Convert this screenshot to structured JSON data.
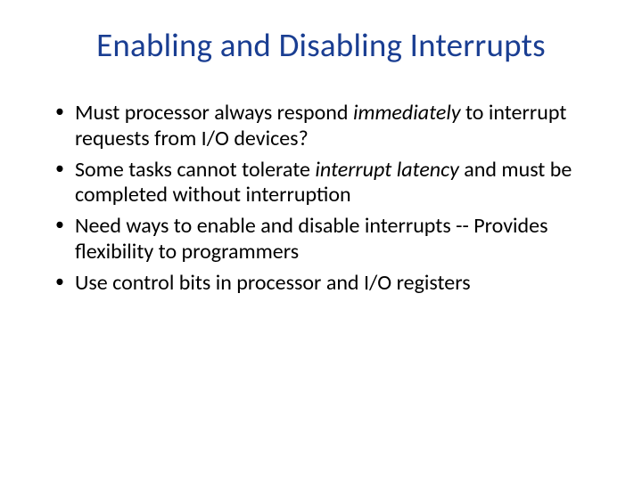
{
  "title": "Enabling and Disabling Interrupts",
  "bullets": [
    {
      "pre": "Must processor always respond ",
      "em": "immediately",
      "post": " to interrupt requests from I/O devices?"
    },
    {
      "pre": "Some tasks cannot tolerate ",
      "em": "interrupt latency",
      "post": " and must be completed without interruption"
    },
    {
      "pre": "Need ways to enable and disable interrupts -- Provides flexibility to programmers",
      "em": "",
      "post": ""
    },
    {
      "pre": "Use control bits in processor and I/O registers",
      "em": "",
      "post": ""
    }
  ]
}
